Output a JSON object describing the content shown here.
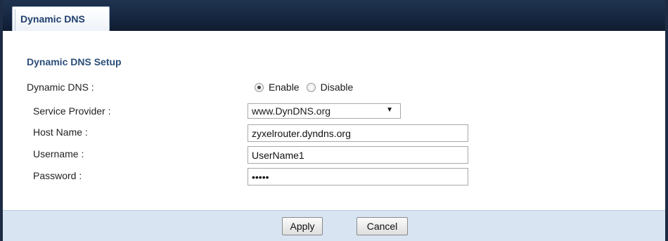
{
  "tabs": [
    {
      "label": "Dynamic DNS"
    }
  ],
  "section": {
    "title": "Dynamic DNS Setup"
  },
  "dynamic_dns": {
    "label": "Dynamic DNS :",
    "options": [
      {
        "label": "Enable",
        "checked": true
      },
      {
        "label": "Disable",
        "checked": false
      }
    ]
  },
  "service_provider": {
    "label": "Service Provider :",
    "selected": "www.DynDNS.org"
  },
  "host_name": {
    "label": "Host Name :",
    "value": "zyxelrouter.dyndns.org"
  },
  "username": {
    "label": "Username :",
    "value": "UserName1"
  },
  "password": {
    "label": "Password :",
    "value": "•••••"
  },
  "buttons": {
    "apply": "Apply",
    "cancel": "Cancel"
  },
  "colors": {
    "header": "#1d2c44",
    "accent_text": "#2b4e7a",
    "footer": "#d8e4f2"
  }
}
